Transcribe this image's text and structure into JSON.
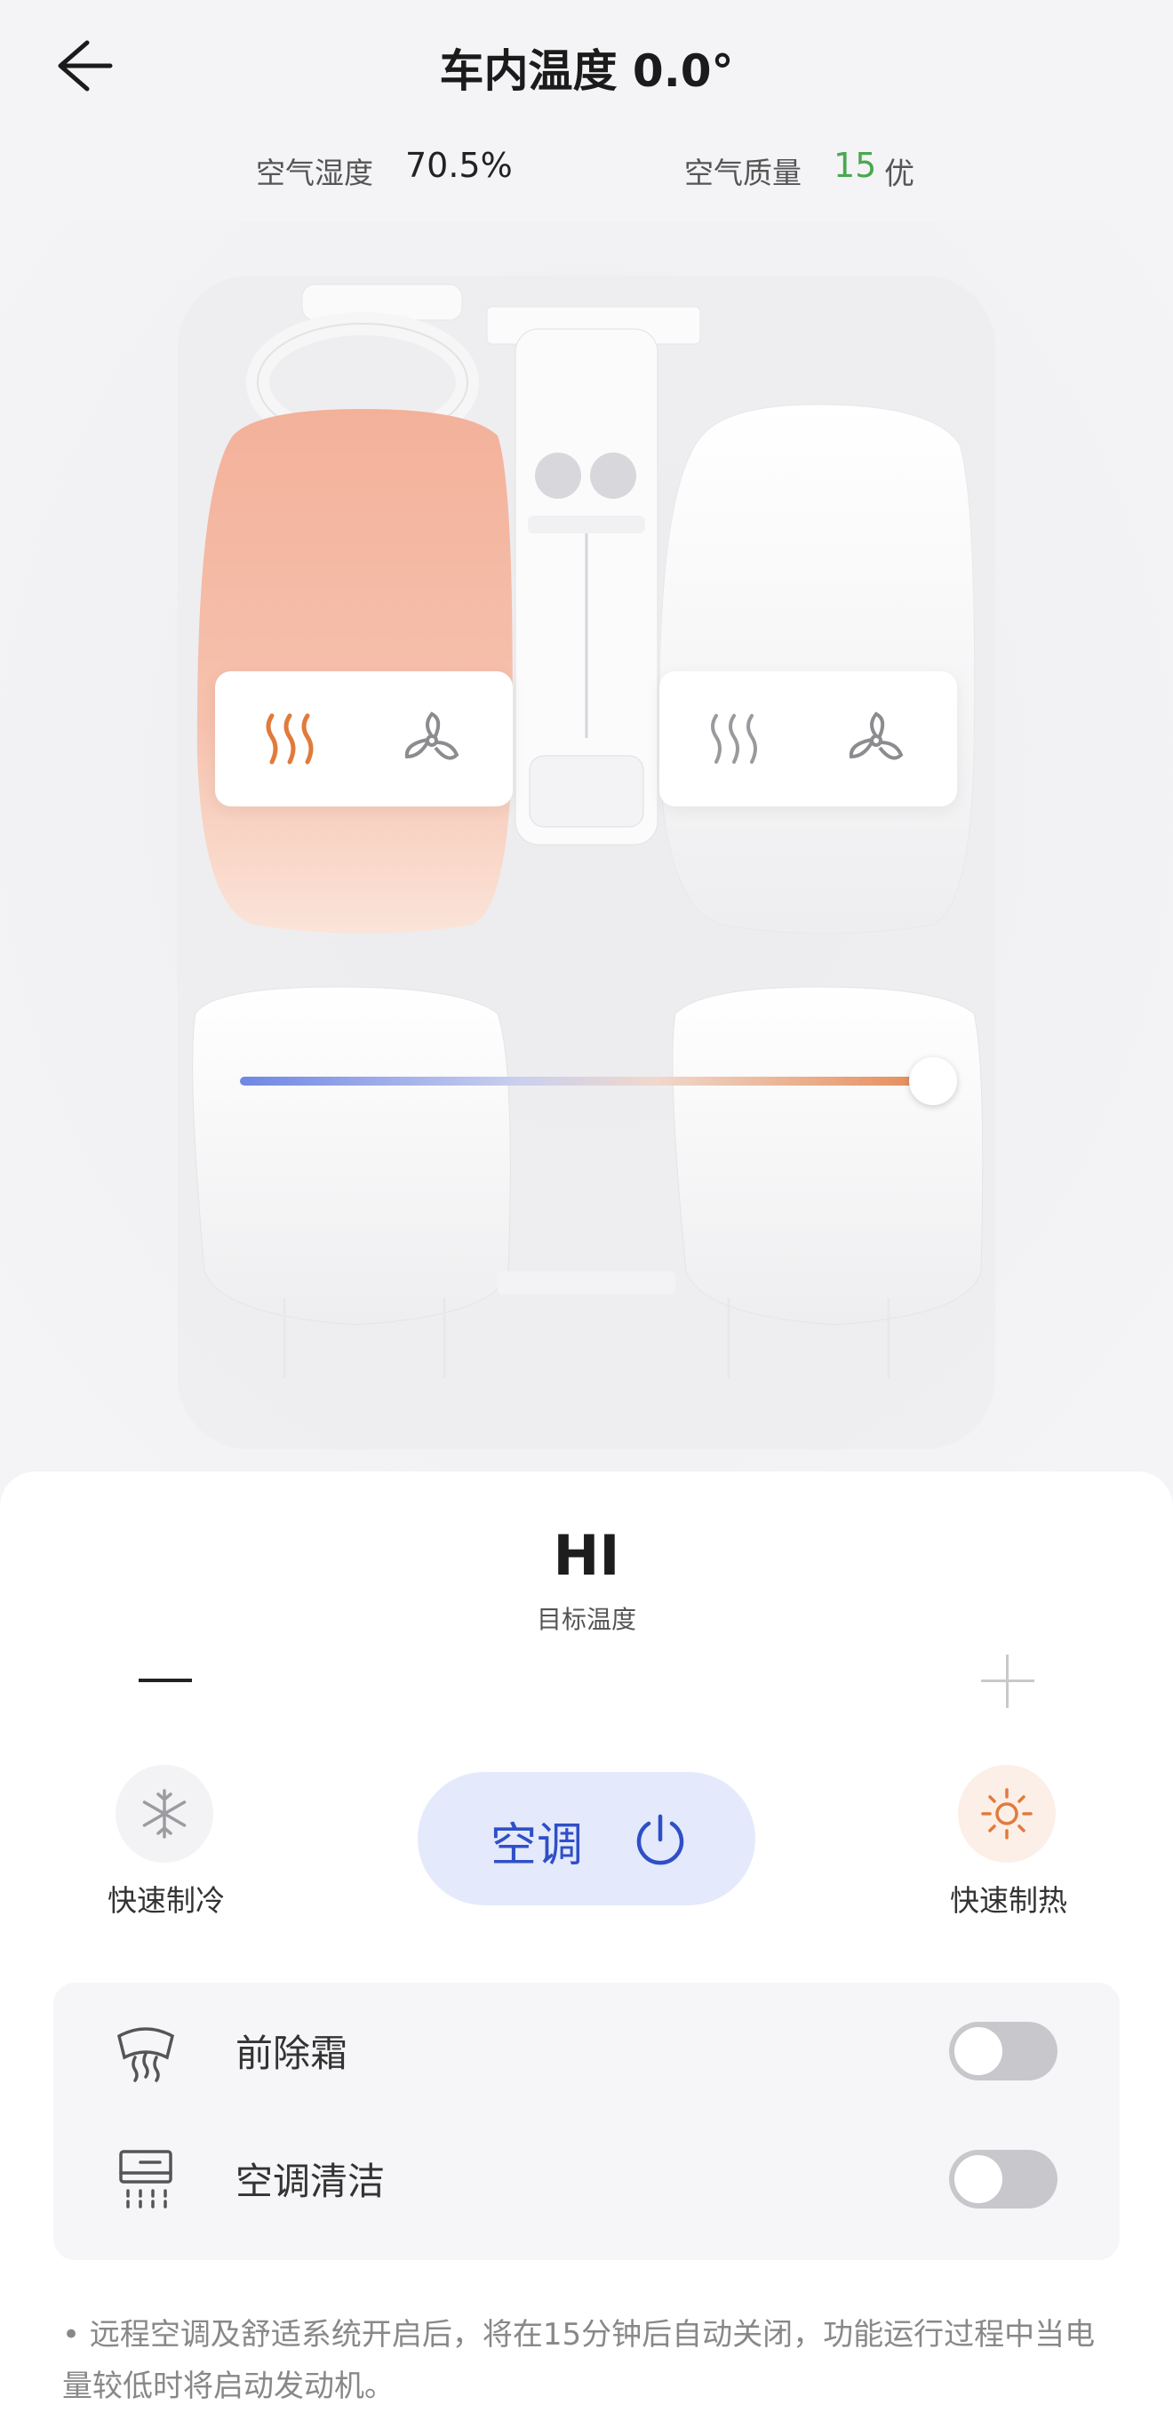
{
  "header": {
    "title": "车内温度 0.0°",
    "back_icon": "arrow-left-icon"
  },
  "stats": {
    "humidity_label": "空气湿度",
    "humidity_value": "70.5%",
    "air_quality_label": "空气质量",
    "air_quality_value": "15",
    "air_quality_level": "优",
    "air_quality_color": "#4aa84f"
  },
  "seats": {
    "driver": {
      "heat_icon": "seat-heat-icon",
      "heat_active": true,
      "fan_icon": "seat-fan-icon",
      "heat_color": "#e07b3c"
    },
    "passenger": {
      "heat_icon": "seat-heat-icon",
      "heat_active": false,
      "fan_icon": "seat-fan-icon"
    }
  },
  "climate": {
    "target_temp": "HI",
    "target_label": "目标温度",
    "slider_level": 1.0,
    "quick_cool_label": "快速制冷",
    "quick_heat_label": "快速制热",
    "ac_label": "空调",
    "ac_color": "#2f4fc7"
  },
  "options": [
    {
      "label": "前除霜",
      "icon": "front-defrost-icon",
      "enabled": false
    },
    {
      "label": "空调清洁",
      "icon": "ac-clean-icon",
      "enabled": false
    }
  ],
  "footnote": "• 远程空调及舒适系统开启后，将在15分钟后自动关闭，功能运行过程中当电量较低时将启动发动机。"
}
